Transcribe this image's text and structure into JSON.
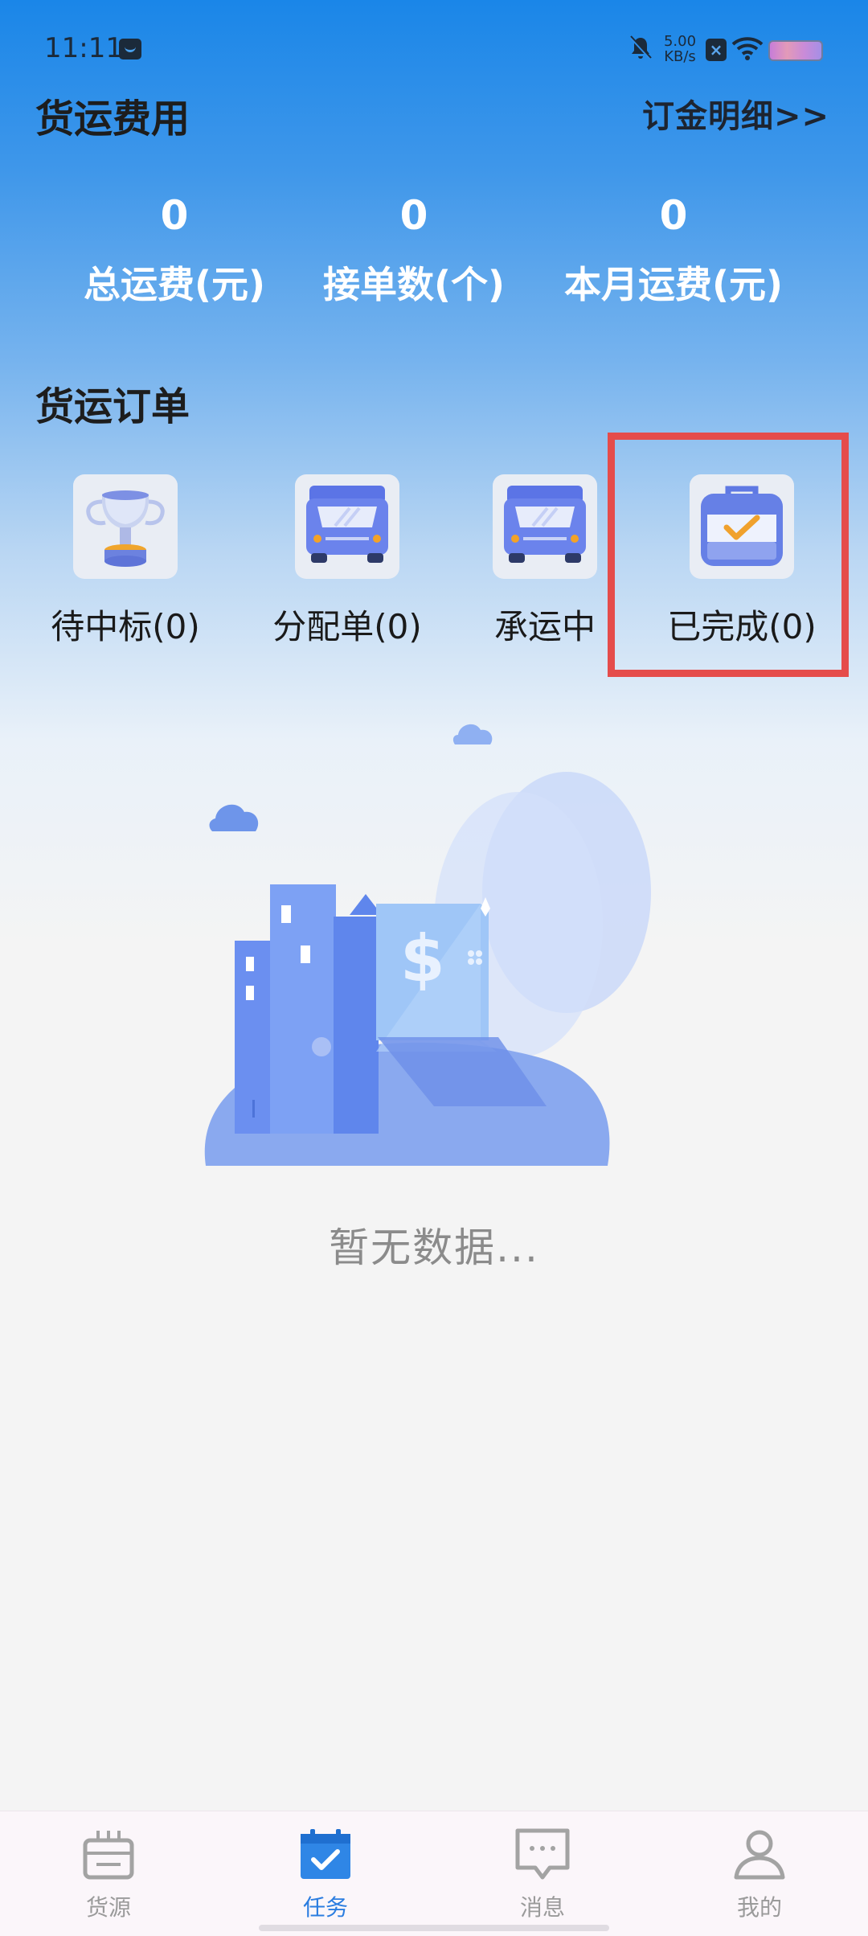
{
  "status_bar": {
    "time": "11:11",
    "net_speed_value": "5.00",
    "net_speed_unit": "KB/s",
    "icons": [
      "mail-icon",
      "bell-mute-icon",
      "close-badge-icon",
      "wifi-icon",
      "battery-icon"
    ]
  },
  "fees": {
    "title": "货运费用",
    "deposit_link": "订金明细>>",
    "stats": [
      {
        "value": "0",
        "label": "总运费(元)"
      },
      {
        "value": "0",
        "label": "接单数(个)"
      },
      {
        "value": "0",
        "label": "本月运费(元)"
      }
    ]
  },
  "orders": {
    "title": "货运订单",
    "items": [
      {
        "label": "待中标(0)",
        "icon": "trophy-icon"
      },
      {
        "label": "分配单(0)",
        "icon": "truck-icon"
      },
      {
        "label": "承运中",
        "icon": "truck-icon"
      },
      {
        "label": "已完成(0)",
        "icon": "bag-check-icon"
      }
    ],
    "highlight_color": "#e54c4b"
  },
  "empty_state": {
    "text": "暂无数据..."
  },
  "bottom_nav": {
    "items": [
      {
        "label": "货源",
        "icon": "cargo-box-icon",
        "active": false
      },
      {
        "label": "任务",
        "icon": "calendar-check-icon",
        "active": true
      },
      {
        "label": "消息",
        "icon": "message-icon",
        "active": false
      },
      {
        "label": "我的",
        "icon": "user-icon",
        "active": false
      }
    ],
    "active_color": "#2b7de0",
    "inactive_color": "#9a9a9a"
  }
}
